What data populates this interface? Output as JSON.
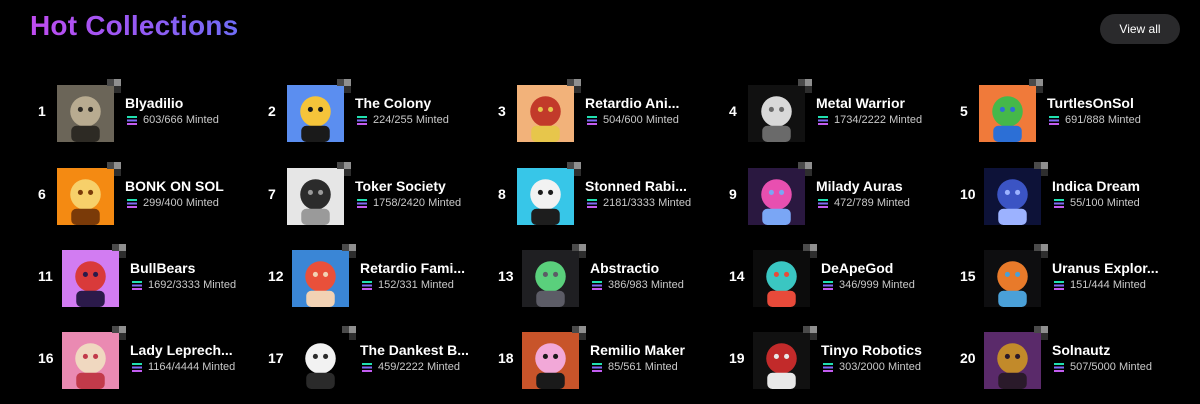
{
  "header": {
    "title": "Hot Collections",
    "view_all_label": "View all"
  },
  "minted_suffix": "Minted",
  "collections": [
    {
      "rank": "1",
      "name": "Blyadilio",
      "minted": "603/666",
      "colors": [
        "#6b6558",
        "#b8ab90",
        "#2d2a24"
      ]
    },
    {
      "rank": "2",
      "name": "The Colony",
      "minted": "224/255",
      "colors": [
        "#5b8ef0",
        "#f5c43a",
        "#1a1a1a"
      ]
    },
    {
      "rank": "3",
      "name": "Retardio Ani...",
      "minted": "504/600",
      "colors": [
        "#f2b27a",
        "#c23a2a",
        "#e7c64b"
      ]
    },
    {
      "rank": "4",
      "name": "Metal Warrior",
      "minted": "1734/2222",
      "colors": [
        "#111111",
        "#d9d9d9",
        "#6a6a6a"
      ]
    },
    {
      "rank": "5",
      "name": "TurtlesOnSol",
      "minted": "691/888",
      "colors": [
        "#f07a3a",
        "#45b84a",
        "#2c6fd6"
      ]
    },
    {
      "rank": "6",
      "name": "BONK ON SOL",
      "minted": "299/400",
      "colors": [
        "#f48a12",
        "#f7d06a",
        "#7a3a08"
      ]
    },
    {
      "rank": "7",
      "name": "Toker Society",
      "minted": "1758/2420",
      "colors": [
        "#e6e6e6",
        "#2b2b2b",
        "#9a9a9a"
      ]
    },
    {
      "rank": "8",
      "name": "Stonned Rabi...",
      "minted": "2181/3333",
      "colors": [
        "#37c6e8",
        "#f2f2f2",
        "#1d1d1d"
      ]
    },
    {
      "rank": "9",
      "name": "Milady Auras",
      "minted": "472/789",
      "colors": [
        "#2a1840",
        "#e84fb0",
        "#7aa6f5"
      ]
    },
    {
      "rank": "10",
      "name": "Indica Dream",
      "minted": "55/100",
      "colors": [
        "#0d1238",
        "#3b54c4",
        "#9cb2ff"
      ]
    },
    {
      "rank": "11",
      "name": "BullBears",
      "minted": "1692/3333",
      "colors": [
        "#d27cf2",
        "#d93a3a",
        "#2b1a4a"
      ]
    },
    {
      "rank": "12",
      "name": "Retardio Fami...",
      "minted": "152/331",
      "colors": [
        "#3a86d6",
        "#e9503a",
        "#f2d2b4"
      ]
    },
    {
      "rank": "13",
      "name": "Abstractio",
      "minted": "386/983",
      "colors": [
        "#1f1f22",
        "#5ad07c",
        "#5c5c66"
      ]
    },
    {
      "rank": "14",
      "name": "DeApeGod",
      "minted": "346/999",
      "colors": [
        "#0c0c0c",
        "#3ac6c2",
        "#e84a3a"
      ]
    },
    {
      "rank": "15",
      "name": "Uranus Explor...",
      "minted": "151/444",
      "colors": [
        "#0e0e10",
        "#e87a2a",
        "#4aa0d8"
      ]
    },
    {
      "rank": "16",
      "name": "Lady Leprech...",
      "minted": "1164/4444",
      "colors": [
        "#ea8ab2",
        "#f0d8c0",
        "#c23a4a"
      ]
    },
    {
      "rank": "17",
      "name": "The Dankest B...",
      "minted": "459/2222",
      "colors": [
        "#000000",
        "#f2f2f2",
        "#2a2a2a"
      ]
    },
    {
      "rank": "18",
      "name": "Remilio Maker",
      "minted": "85/561",
      "colors": [
        "#c8542a",
        "#f2a8d8",
        "#1a1a1a"
      ]
    },
    {
      "rank": "19",
      "name": "Tinyo Robotics",
      "minted": "303/2000",
      "colors": [
        "#111111",
        "#c22a2a",
        "#e8e8e8"
      ]
    },
    {
      "rank": "20",
      "name": "Solnautz",
      "minted": "507/5000",
      "colors": [
        "#5a2a6a",
        "#c28a2a",
        "#2a1a2a"
      ]
    }
  ]
}
